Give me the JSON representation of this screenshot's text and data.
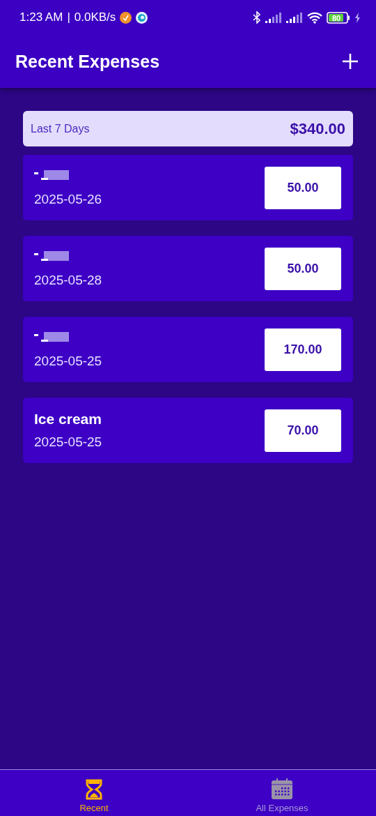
{
  "status_bar": {
    "time": "1:23 AM",
    "separator": "|",
    "speed": "0.0KB/s",
    "battery": "80"
  },
  "app_bar": {
    "title": "Recent Expenses"
  },
  "summary": {
    "label": "Last 7 Days",
    "total": "$340.00"
  },
  "expenses": [
    {
      "kind": "redacted",
      "date": "2025-05-26",
      "amount": "50.00"
    },
    {
      "kind": "redacted",
      "date": "2025-05-28",
      "amount": "50.00"
    },
    {
      "kind": "redacted",
      "date": "2025-05-25",
      "amount": "170.00"
    },
    {
      "kind": "named",
      "title": "Ice cream",
      "date": "2025-05-25",
      "amount": "70.00"
    }
  ],
  "nav": [
    {
      "kind": "recent",
      "label": "Recent",
      "selected": true
    },
    {
      "kind": "all",
      "label": "All Expenses",
      "selected": false
    }
  ]
}
